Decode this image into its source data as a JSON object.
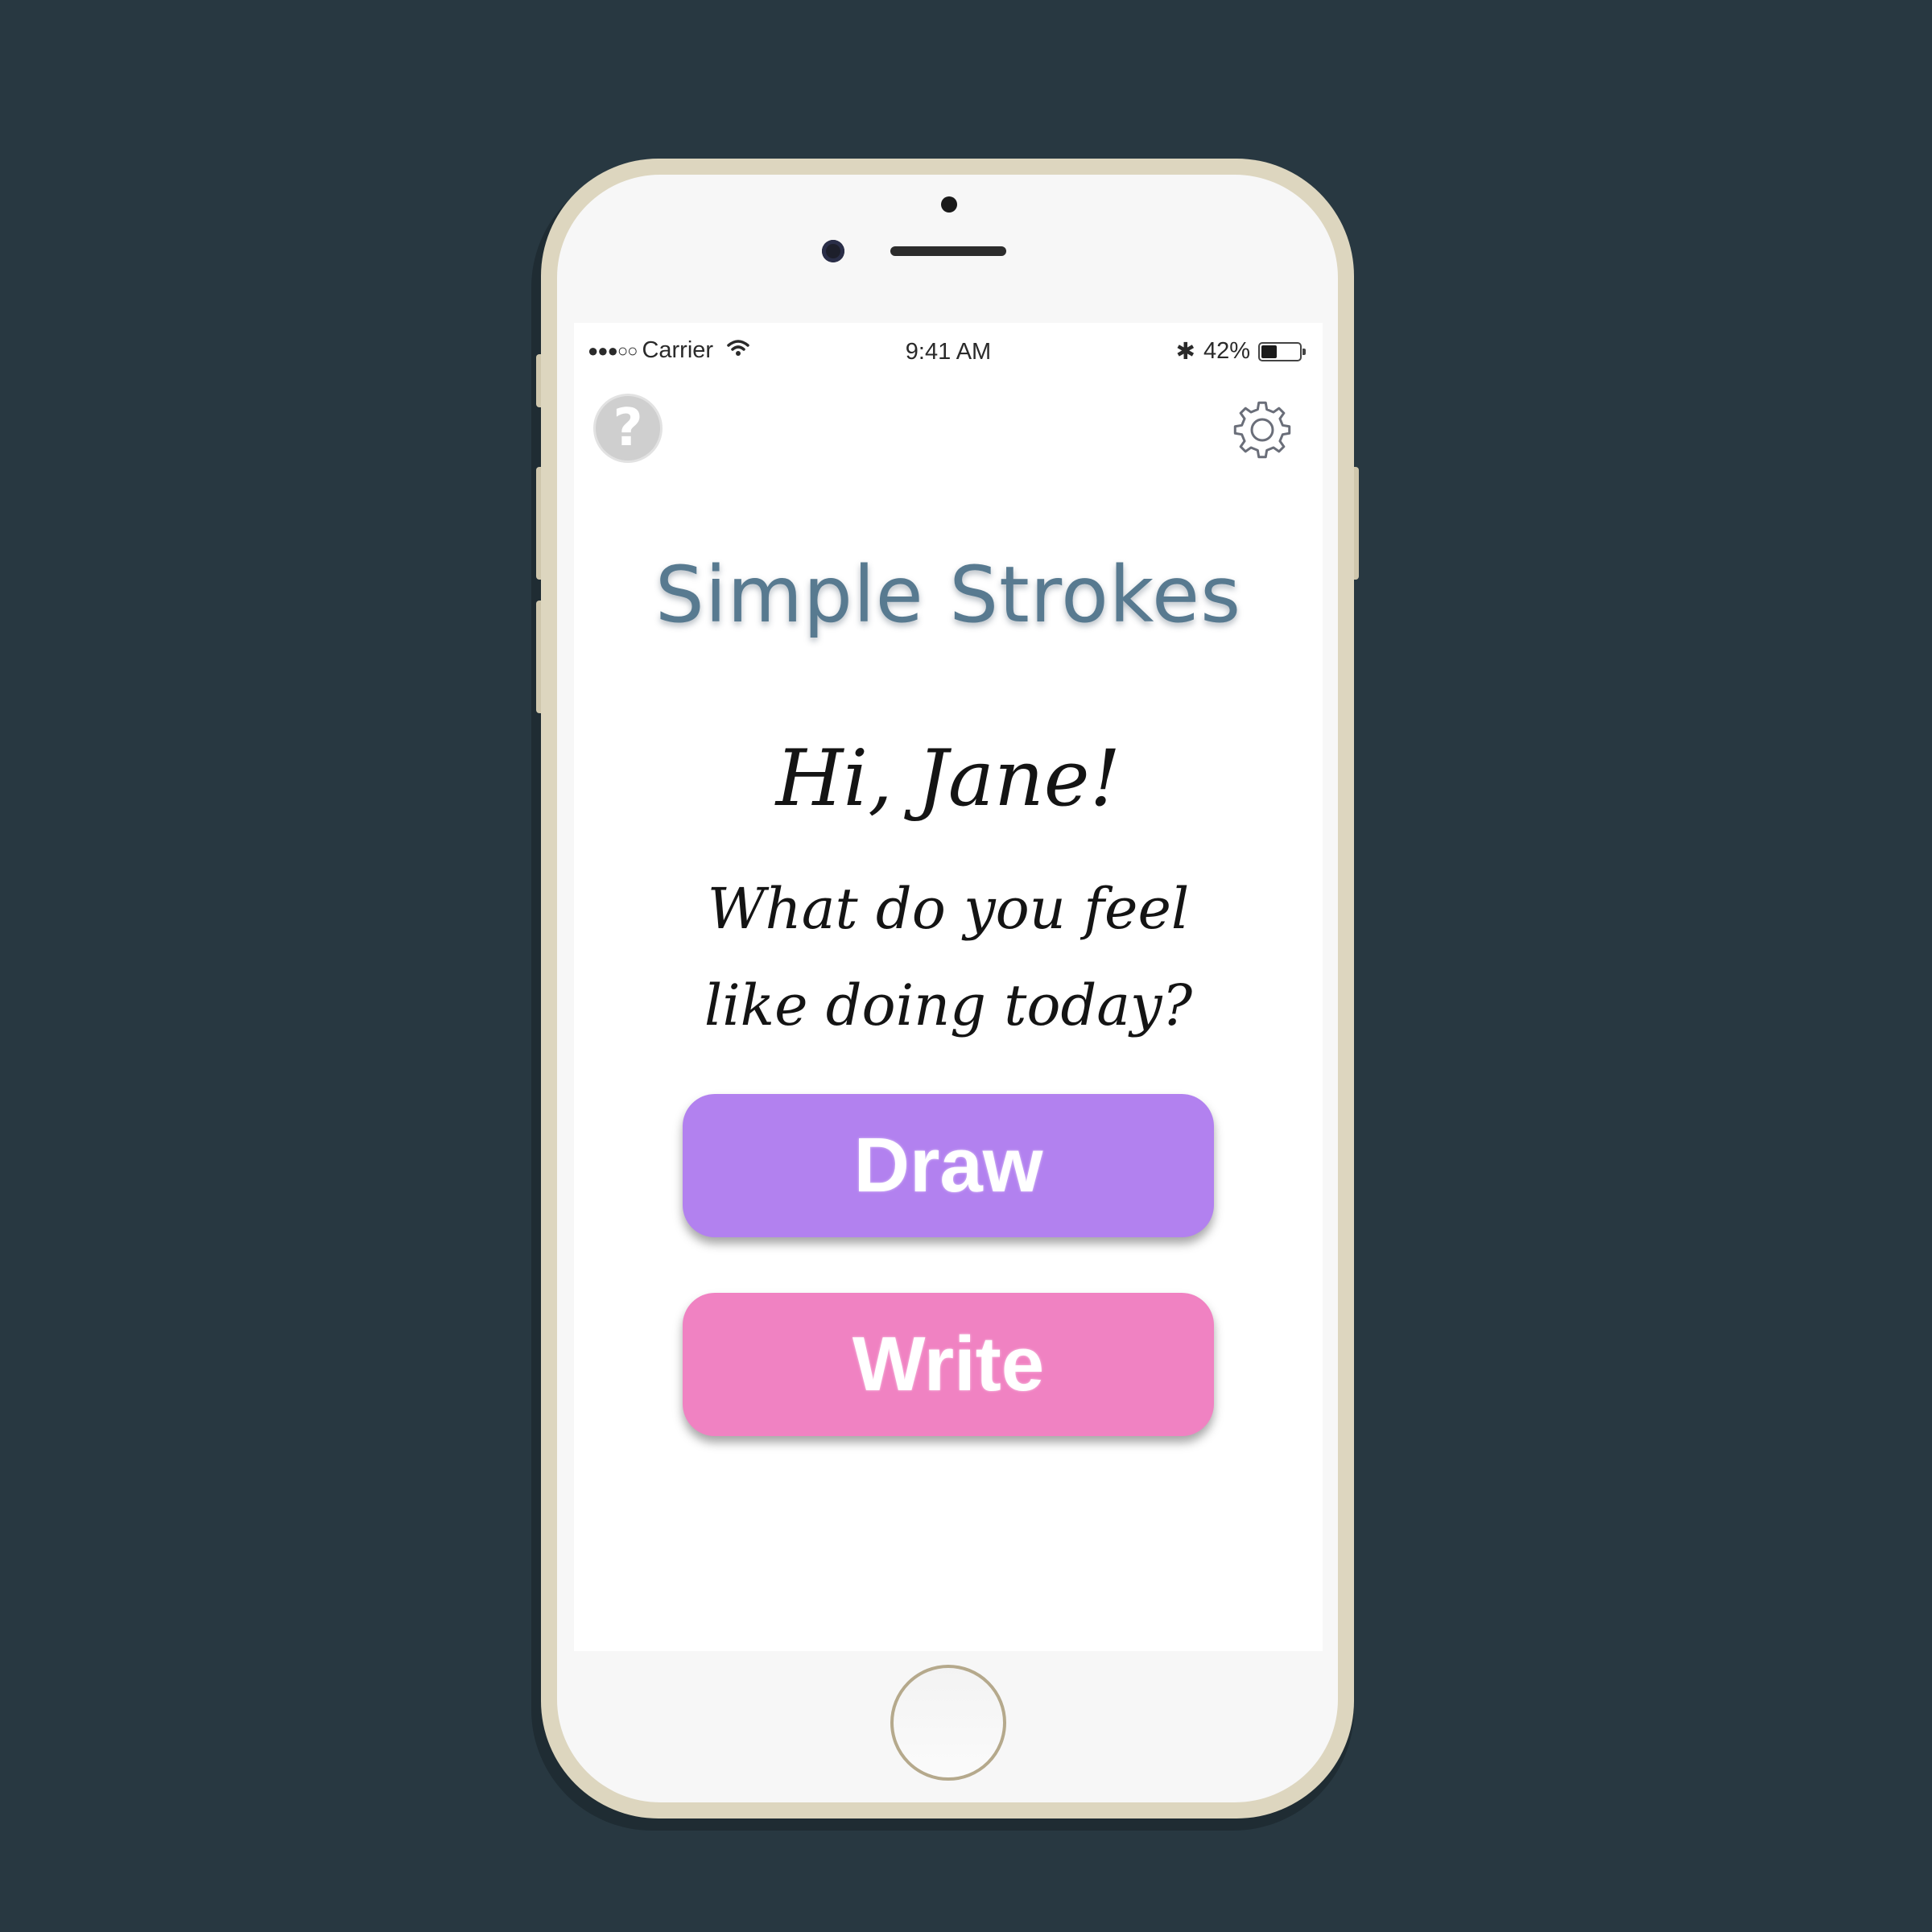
{
  "status_bar": {
    "signal": "●●●○○",
    "carrier": "Carrier",
    "time": "9:41 AM",
    "bluetooth": "✱",
    "battery_percent": "42%",
    "battery_level": 0.42
  },
  "toolbar": {
    "help_label": "?",
    "help_icon": "question-circle-icon",
    "settings_icon": "gear-icon"
  },
  "main": {
    "app_title": "Simple Strokes",
    "greeting": "Hi, Jane!",
    "prompt": "What do you feel like doing today?"
  },
  "actions": {
    "draw_label": "Draw",
    "write_label": "Write"
  },
  "colors": {
    "background": "#283841",
    "phone_frame": "#ddd6bf",
    "title": "#587a90",
    "draw_button": "#b281ef",
    "write_button": "#f082c2",
    "help_icon": "#cfcfcf",
    "settings_icon": "#6a6e79"
  }
}
